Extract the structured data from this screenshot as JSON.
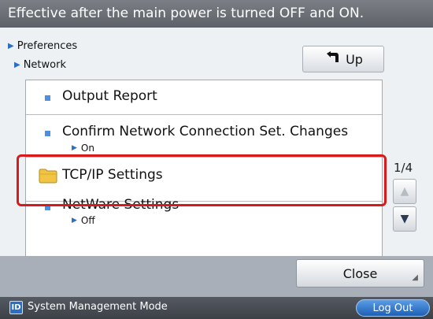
{
  "header": {
    "message": "Effective after the main power is turned OFF and ON."
  },
  "breadcrumb": {
    "level1": "Preferences",
    "level2": "Network"
  },
  "nav": {
    "up_label": "Up"
  },
  "list": {
    "items": [
      {
        "title": "Output Report",
        "sub": ""
      },
      {
        "title": "Confirm Network Connection Set. Changes",
        "sub": "On"
      },
      {
        "title": "TCP/IP Settings",
        "sub": ""
      },
      {
        "title": "NetWare Settings",
        "sub": "Off"
      }
    ],
    "selected_index": 2
  },
  "pager": {
    "label": "1/4"
  },
  "footer": {
    "close_label": "Close"
  },
  "status": {
    "mode_icon_letter": "ID",
    "mode_label": "System Management Mode",
    "logout_label": "Log Out"
  },
  "colors": {
    "accent": "#2a6fc3",
    "highlight": "#d51b1b"
  },
  "icons": {
    "up": "return-arrow-icon",
    "folder": "folder-icon",
    "scroll_up": "triangle-up-icon",
    "scroll_down": "triangle-down-icon"
  }
}
